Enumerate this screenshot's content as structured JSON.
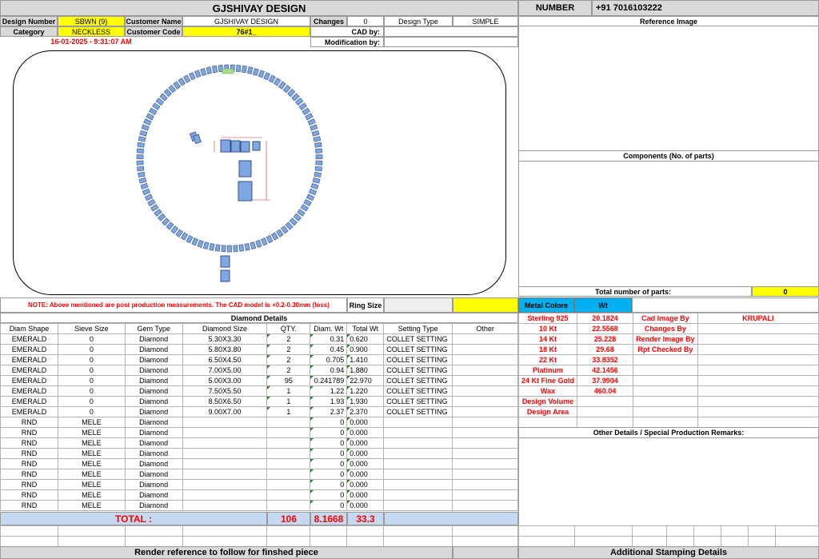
{
  "header": {
    "title": "GJSHIVAY DESIGN",
    "number_label": "NUMBER",
    "number_value": "+91 7016103222",
    "design_number_label": "Design Number",
    "design_number_value": "SBWN (9)",
    "customer_name_label": "Customer Name",
    "customer_name_value": "GJSHIVAY DESIGN",
    "changes_label": "Changes",
    "changes_value": "0",
    "design_type_label": "Design Type",
    "design_type_value": "SIMPLE",
    "category_label": "Category",
    "category_value": "NECKLESS",
    "customer_code_label": "Customer Code",
    "customer_code_value": "76#1_",
    "cad_by_label": "CAD by:",
    "timestamp": "16-01-2025 - 9:31:07 AM",
    "modification_label": "Modification by:"
  },
  "right_panel": {
    "reference_image_label": "Reference Image",
    "components_label": "Components (No. of parts)",
    "total_parts_label": "Total number of parts:",
    "total_parts_value": "0",
    "metal_colore_label": "Metal Colore",
    "wt_label": "Wt",
    "other_details_label": "Other Details / Special Production Remarks:",
    "additional_stamping": "Additional Stamping Details"
  },
  "metals": [
    {
      "name": "Sterling 925",
      "wt": "20.1824"
    },
    {
      "name": "10 Kt",
      "wt": "22.5568"
    },
    {
      "name": "14 Kt",
      "wt": "25.228"
    },
    {
      "name": "18 Kt",
      "wt": "29.68"
    },
    {
      "name": "22 Kt",
      "wt": "33.8352"
    },
    {
      "name": "Platinum",
      "wt": "42.1456"
    },
    {
      "name": "24 Kt Fine Gold",
      "wt": "37.9904"
    },
    {
      "name": "Wax",
      "wt": "460.04"
    },
    {
      "name": "Design Volume",
      "wt": ""
    },
    {
      "name": "Design Area",
      "wt": ""
    }
  ],
  "credits": [
    {
      "label": "Cad Image By",
      "value": "KRUPALI"
    },
    {
      "label": "Changes By",
      "value": ""
    },
    {
      "label": "Render Image By",
      "value": ""
    },
    {
      "label": "Rpt Checked By",
      "value": ""
    }
  ],
  "note": "NOTE: Above mentioned are post production measurements. The CAD model is +0.2-0.30mm (loss)",
  "ring_size_label": "Ring Size",
  "diamond_details_label": "Diamond Details",
  "columns": [
    "Diam Shape",
    "Sieve Size",
    "Gem Type",
    "Diamond Size",
    "QTY.",
    "Diam. Wt",
    "Total Wt",
    "Setting Type",
    "Other"
  ],
  "rows": [
    [
      "EMERALD",
      "0",
      "Diamond",
      "5.30X3.30",
      "2",
      "0.31",
      "0.620",
      "COLLET SETTING",
      ""
    ],
    [
      "EMERALD",
      "0",
      "Diamond",
      "5.80X3.80",
      "2",
      "0.45",
      "0.900",
      "COLLET SETTING",
      ""
    ],
    [
      "EMERALD",
      "0",
      "Diamond",
      "6.50X4.50",
      "2",
      "0.705",
      "1.410",
      "COLLET SETTING",
      ""
    ],
    [
      "EMERALD",
      "0",
      "Diamond",
      "7.00X5.00",
      "2",
      "0.94",
      "1.880",
      "COLLET SETTING",
      ""
    ],
    [
      "EMERALD",
      "0",
      "Diamond",
      "5.00X3.00",
      "95",
      "0.241789",
      "22.970",
      "COLLET SETTING",
      ""
    ],
    [
      "EMERALD",
      "0",
      "Diamond",
      "7.50X5.50",
      "1",
      "1.22",
      "1.220",
      "COLLET SETTING",
      ""
    ],
    [
      "EMERALD",
      "0",
      "Diamond",
      "8.50X6.50",
      "1",
      "1.93",
      "1.930",
      "COLLET SETTING",
      ""
    ],
    [
      "EMERALD",
      "0",
      "Diamond",
      "9.00X7.00",
      "1",
      "2.37",
      "2.370",
      "COLLET SETTING",
      ""
    ],
    [
      "RND",
      "MELE",
      "Diamond",
      "",
      "",
      "0",
      "0.000",
      "",
      ""
    ],
    [
      "RND",
      "MELE",
      "Diamond",
      "",
      "",
      "0",
      "0.000",
      "",
      ""
    ],
    [
      "RND",
      "MELE",
      "Diamond",
      "",
      "",
      "0",
      "0.000",
      "",
      ""
    ],
    [
      "RND",
      "MELE",
      "Diamond",
      "",
      "",
      "0",
      "0.000",
      "",
      ""
    ],
    [
      "RND",
      "MELE",
      "Diamond",
      "",
      "",
      "0",
      "0.000",
      "",
      ""
    ],
    [
      "RND",
      "MELE",
      "Diamond",
      "",
      "",
      "0",
      "0.000",
      "",
      ""
    ],
    [
      "RND",
      "MELE",
      "Diamond",
      "",
      "",
      "0",
      "0.000",
      "",
      ""
    ],
    [
      "RND",
      "MELE",
      "Diamond",
      "",
      "",
      "0",
      "0.000",
      "",
      ""
    ],
    [
      "RND",
      "MELE",
      "Diamond",
      "",
      "",
      "0",
      "0.000",
      "",
      ""
    ]
  ],
  "totals": {
    "label": "TOTAL :",
    "qty": "106",
    "diam_wt": "8.1668",
    "total_wt": "33.3"
  },
  "footer": {
    "render_reference": "Render reference to follow for finshed piece"
  },
  "colors": {
    "highlight": "#ffff00",
    "metal_header": "#00b0f0",
    "total_bg": "#c5d9f1",
    "red_text": "#ff0000",
    "stone": "#7ea6e0"
  }
}
